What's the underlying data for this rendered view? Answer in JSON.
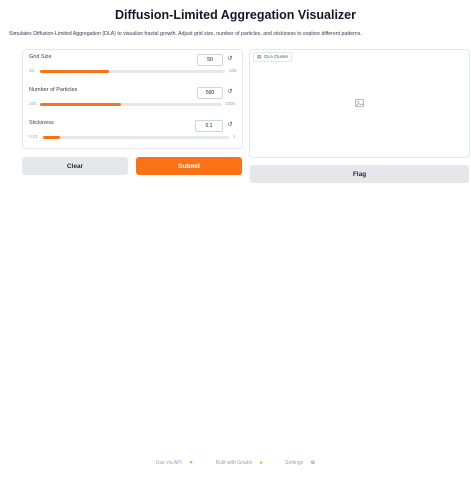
{
  "title": "Diffusion-Limited Aggregation Visualizer",
  "description": "Simulates Diffusion-Limited Aggregation (DLA) to visualize fractal growth. Adjust grid size, number of particles, and stickiness to explore different patterns.",
  "inputs": {
    "grid_size": {
      "label": "Grid Size",
      "value": "50",
      "min": "20",
      "max": "100",
      "fraction": 0.375
    },
    "num_particles": {
      "label": "Number of Particles",
      "value": "500",
      "min": "100",
      "max": "1000",
      "fraction": 0.444
    },
    "stickiness": {
      "label": "Stickiness",
      "value": "0.1",
      "min": "0.01",
      "max": "1",
      "fraction": 0.091
    }
  },
  "buttons": {
    "clear": "Clear",
    "submit": "Submit",
    "flag": "Flag"
  },
  "output": {
    "label": "DLA Cluster"
  },
  "footer": {
    "api": "Use via API",
    "built": "Built with Gradio",
    "settings": "Settings"
  },
  "colors": {
    "accent": "#f97316",
    "neutral_button": "#e5e7eb"
  }
}
